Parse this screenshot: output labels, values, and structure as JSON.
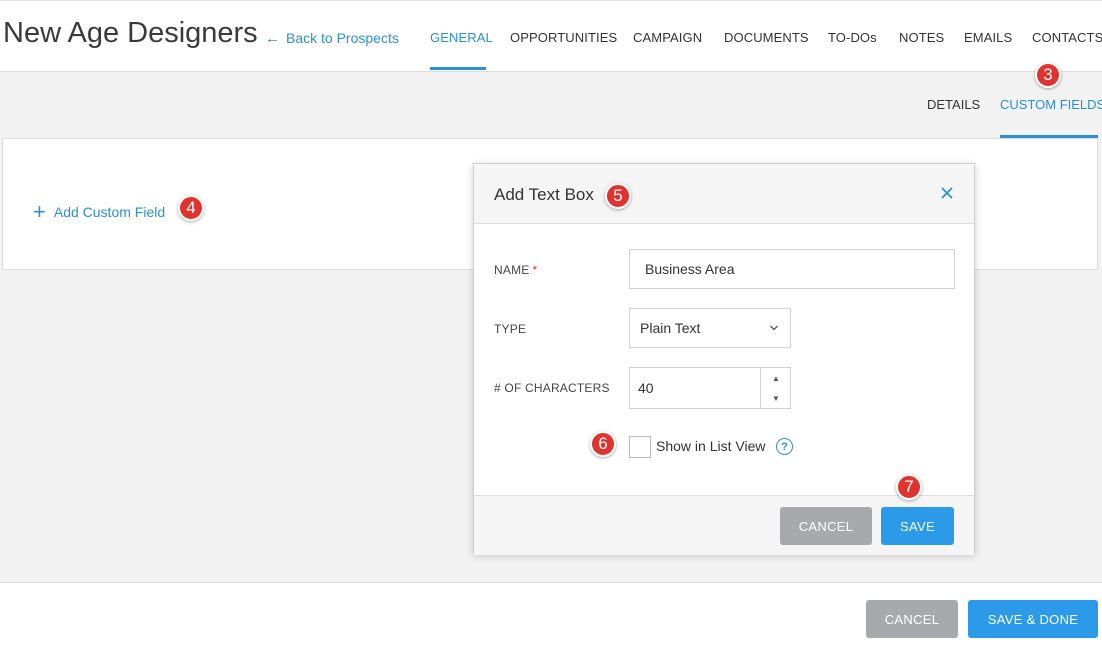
{
  "header": {
    "title": "New Age Designers",
    "back_link": "Back to Prospects",
    "tabs": [
      {
        "label": "GENERAL",
        "active": true
      },
      {
        "label": "OPPORTUNITIES"
      },
      {
        "label": "CAMPAIGN"
      },
      {
        "label": "DOCUMENTS"
      },
      {
        "label": "TO-DOs"
      },
      {
        "label": "NOTES"
      },
      {
        "label": "EMAILS"
      },
      {
        "label": "CONTACTS"
      }
    ]
  },
  "subtabs": [
    {
      "label": "DETAILS"
    },
    {
      "label": "CUSTOM FIELDS",
      "active": true
    }
  ],
  "card": {
    "add_custom_field": "Add Custom Field"
  },
  "modal": {
    "title": "Add Text Box",
    "name_label": "NAME",
    "required_mark": "*",
    "name_value": "Business Area",
    "type_label": "TYPE",
    "type_value": "Plain Text",
    "chars_label": "# OF CHARACTERS",
    "chars_value": "40",
    "show_in_list_label": "Show in List View",
    "show_in_list_checked": false,
    "help_glyph": "?",
    "cancel_label": "CANCEL",
    "save_label": "SAVE"
  },
  "footer": {
    "cancel_label": "CANCEL",
    "save_done_label": "SAVE & DONE"
  },
  "badges": {
    "custom_fields": "3",
    "add_custom_field": "4",
    "modal_title": "5",
    "show_in_list": "6",
    "save": "7"
  },
  "colors": {
    "accent": "#2b8fd6",
    "badge": "#e0332f",
    "button_grey": "#a7a9ac",
    "button_blue": "#2b9ae8",
    "workspace_bg": "#f2f2f2"
  },
  "icons": {
    "back": "arrow-left-icon",
    "add": "plus-icon",
    "close": "close-icon",
    "select": "chevron-down-icon",
    "help": "question-circle-icon"
  }
}
